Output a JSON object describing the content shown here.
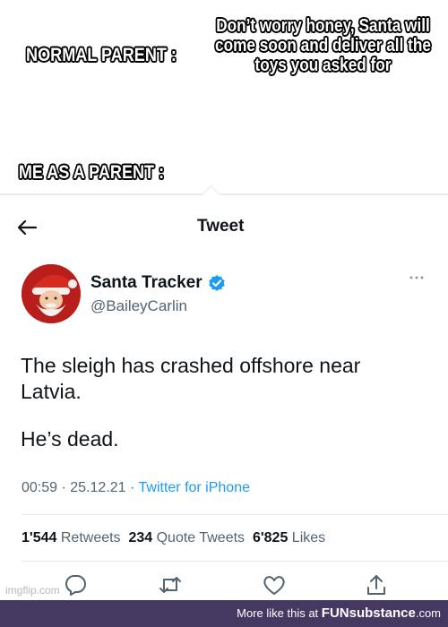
{
  "meme": {
    "normal_parent": "NORMAL PARENT :",
    "santa_reply": "Don’t worry honey, Santa will come soon and deliver all the toys you asked for",
    "me_as_parent": "ME AS A PARENT :"
  },
  "header": {
    "title": "Tweet",
    "back_icon": "arrow-left-icon"
  },
  "tweet": {
    "author_name": "Santa Tracker",
    "author_handle": "@BaileyCarlin",
    "verified": true,
    "text_line1": "The sleigh has crashed offshore near",
    "text_line2": "Latvia.",
    "text_line3": "He’s dead.",
    "time": "00:59",
    "date": "25.12.21",
    "source": "Twitter for iPhone",
    "retweets_count": "1'544",
    "retweets_label": "Retweets",
    "quote_count": "234",
    "quote_label": "Quote Tweets",
    "likes_count": "6'825",
    "likes_label": "Likes"
  },
  "actions": [
    "reply-icon",
    "retweet-icon",
    "like-icon",
    "share-icon"
  ],
  "colors": {
    "link": "#1d9bf0",
    "footer_bg": "#453861",
    "text_primary": "#0f1419",
    "text_secondary": "#536471"
  },
  "watermark": "imgflip.com",
  "footer": {
    "prefix": "More like this at",
    "brand_a": "FUN",
    "brand_b": "substance",
    "brand_c": ".com"
  }
}
